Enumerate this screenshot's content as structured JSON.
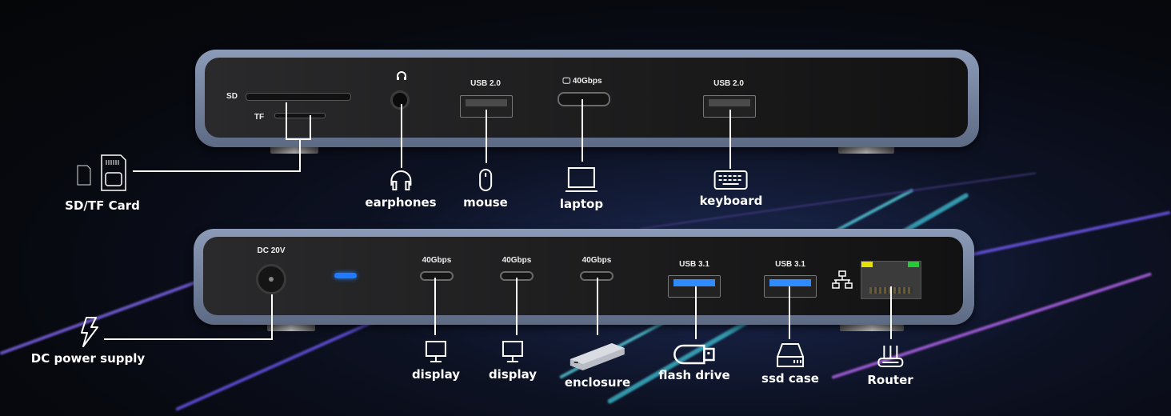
{
  "top_dock": {
    "port_labels": {
      "sd": "SD",
      "tf": "TF",
      "usb_left": "USB 2.0",
      "thunderbolt": "40Gbps",
      "usb_right": "USB 2.0"
    }
  },
  "bottom_dock": {
    "port_labels": {
      "dc": "DC 20V",
      "tc1": "40Gbps",
      "tc2": "40Gbps",
      "tc3": "40Gbps",
      "usb3_1": "USB 3.1",
      "usb3_2": "USB 3.1"
    }
  },
  "devices_top": {
    "sdtf": "SD/TF Card",
    "earphones": "earphones",
    "mouse": "mouse",
    "laptop": "laptop",
    "keyboard": "keyboard"
  },
  "devices_bottom": {
    "dc": "DC power supply",
    "display1": "display",
    "display2": "display",
    "enclosure": "enclosure",
    "flash": "flash drive",
    "ssd": "ssd case",
    "router": "Router"
  },
  "colors": {
    "led_blue": "#1f7bff",
    "usb3_blue": "#2f8bff",
    "eth_led_yellow": "#e8e000",
    "eth_led_green": "#22cc33"
  }
}
